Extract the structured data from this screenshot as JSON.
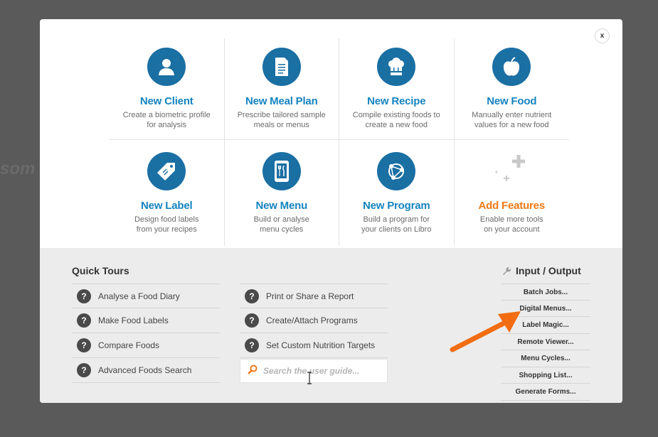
{
  "background": {
    "partial_text": "som"
  },
  "modal": {
    "close_label": "x"
  },
  "tiles": [
    {
      "title": "New Client",
      "desc1": "Create a biometric profile",
      "desc2": "for analysis",
      "icon": "person-icon"
    },
    {
      "title": "New Meal Plan",
      "desc1": "Prescribe tailored sample",
      "desc2": "meals or menus",
      "icon": "document-icon"
    },
    {
      "title": "New Recipe",
      "desc1": "Compile existing foods to",
      "desc2": "create a new food",
      "icon": "chef-hat-icon"
    },
    {
      "title": "New Food",
      "desc1": "Manually enter nutrient",
      "desc2": "values for a new food",
      "icon": "apple-icon"
    },
    {
      "title": "New Label",
      "desc1": "Design food labels",
      "desc2": "from your recipes",
      "icon": "tag-icon"
    },
    {
      "title": "New Menu",
      "desc1": "Build or analyse",
      "desc2": "menu cycles",
      "icon": "tablet-cutlery-icon"
    },
    {
      "title": "New Program",
      "desc1": "Build a program for",
      "desc2": "your clients on Libro",
      "icon": "network-icon"
    },
    {
      "title": "Add Features",
      "desc1": "Enable more tools",
      "desc2": "on your account",
      "icon": "plus-icon"
    }
  ],
  "quick_tours": {
    "title": "Quick Tours",
    "col1": [
      "Analyse a Food Diary",
      "Make Food Labels",
      "Compare Foods",
      "Advanced Foods Search"
    ],
    "col2": [
      "Print or Share a Report",
      "Create/Attach Programs",
      "Set Custom Nutrition Targets"
    ],
    "search_placeholder": "Search the user guide..."
  },
  "io": {
    "title": "Input / Output",
    "items": [
      "Batch Jobs...",
      "Digital Menus...",
      "Label Magic...",
      "Remote Viewer...",
      "Menu Cycles...",
      "Shopping List...",
      "Generate Forms..."
    ]
  },
  "colors": {
    "accent": "#1584bf",
    "icon_bg": "#1a6fa3",
    "orange": "#f07a18",
    "panel": "#ececec"
  }
}
